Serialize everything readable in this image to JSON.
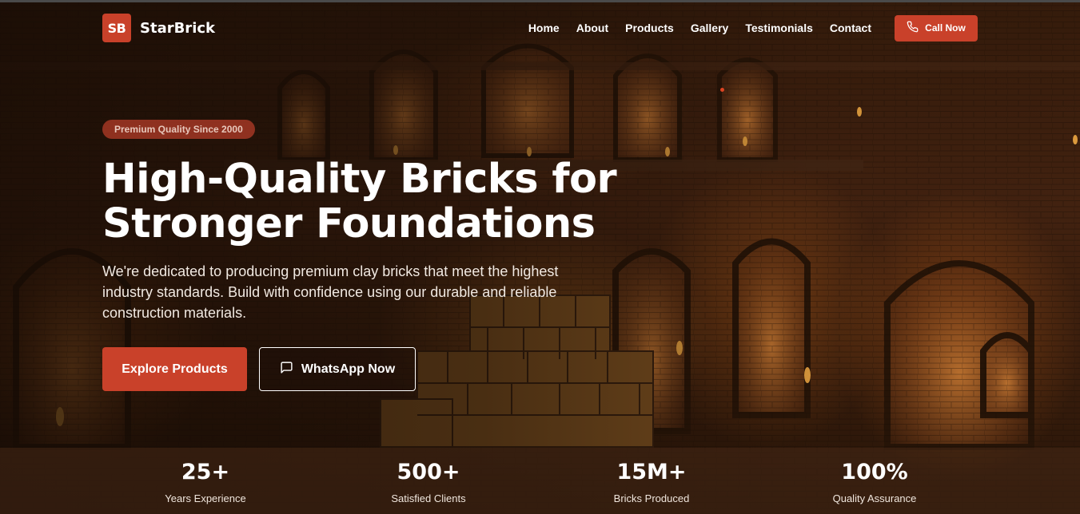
{
  "brand": {
    "logo_text": "SB",
    "name": "StarBrick"
  },
  "nav": {
    "links": [
      "Home",
      "About",
      "Products",
      "Gallery",
      "Testimonials",
      "Contact"
    ],
    "call_label": "Call Now"
  },
  "hero": {
    "badge": "Premium Quality Since 2000",
    "title_line1": "High-Quality Bricks for",
    "title_line2": "Stronger Foundations",
    "subtitle": "We're dedicated to producing premium clay bricks that meet the highest industry standards. Build with confidence using our durable and reliable construction materials.",
    "primary_cta": "Explore Products",
    "secondary_cta": "WhatsApp Now"
  },
  "stats": [
    {
      "value": "25+",
      "label": "Years Experience"
    },
    {
      "value": "500+",
      "label": "Satisfied Clients"
    },
    {
      "value": "15M+",
      "label": "Bricks Produced"
    },
    {
      "value": "100%",
      "label": "Quality Assurance"
    }
  ],
  "colors": {
    "accent": "#c9412a",
    "background": "#3a1e0c"
  },
  "icons": {
    "call": "phone-icon",
    "whatsapp": "chat-bubble-icon"
  }
}
